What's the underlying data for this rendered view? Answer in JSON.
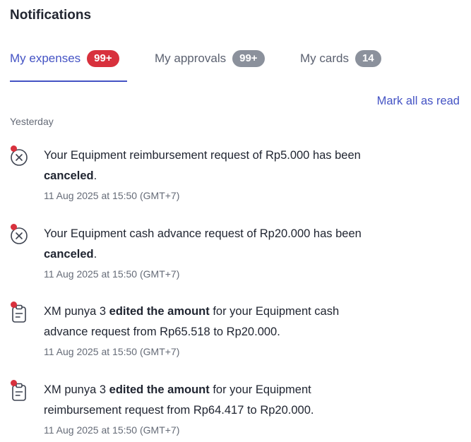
{
  "header": {
    "title": "Notifications"
  },
  "tabs": [
    {
      "label": "My expenses",
      "badge": "99+",
      "badge_color": "#d8313d",
      "active": true
    },
    {
      "label": "My approvals",
      "badge": "99+",
      "badge_color": "#8b919c",
      "active": false
    },
    {
      "label": "My cards",
      "badge": "14",
      "badge_color": "#8b919c",
      "active": false
    }
  ],
  "actions": {
    "mark_all_read": "Mark all as read"
  },
  "section": {
    "label": "Yesterday"
  },
  "notifications": [
    {
      "icon": "cancel-circle-icon",
      "unread": true,
      "line1": {
        "pre": "Your Equipment reimbursement request of Rp5.000 has been",
        "bold": "",
        "post": ""
      },
      "line2": {
        "pre": "",
        "bold": "canceled",
        "post": "."
      },
      "time": "11 Aug 2025 at 15:50 (GMT+7)"
    },
    {
      "icon": "cancel-circle-icon",
      "unread": true,
      "line1": {
        "pre": "Your Equipment cash advance request of Rp20.000 has been",
        "bold": "",
        "post": ""
      },
      "line2": {
        "pre": "",
        "bold": "canceled",
        "post": "."
      },
      "time": "11 Aug 2025 at 15:50 (GMT+7)"
    },
    {
      "icon": "clipboard-edit-icon",
      "unread": true,
      "line1": {
        "pre": "XM punya 3 ",
        "bold": "edited the amount",
        "post": " for your Equipment cash"
      },
      "line2": {
        "pre": "advance request from Rp65.518 to Rp20.000.",
        "bold": "",
        "post": ""
      },
      "time": "11 Aug 2025 at 15:50 (GMT+7)"
    },
    {
      "icon": "clipboard-edit-icon",
      "unread": true,
      "line1": {
        "pre": "XM punya 3 ",
        "bold": "edited the amount",
        "post": " for your Equipment"
      },
      "line2": {
        "pre": "reimbursement request from Rp64.417 to Rp20.000.",
        "bold": "",
        "post": ""
      },
      "time": "11 Aug 2025 at 15:50 (GMT+7)"
    }
  ],
  "colors": {
    "accent": "#4453c4",
    "unread_dot": "#d8313d",
    "muted_badge": "#8b919c"
  }
}
